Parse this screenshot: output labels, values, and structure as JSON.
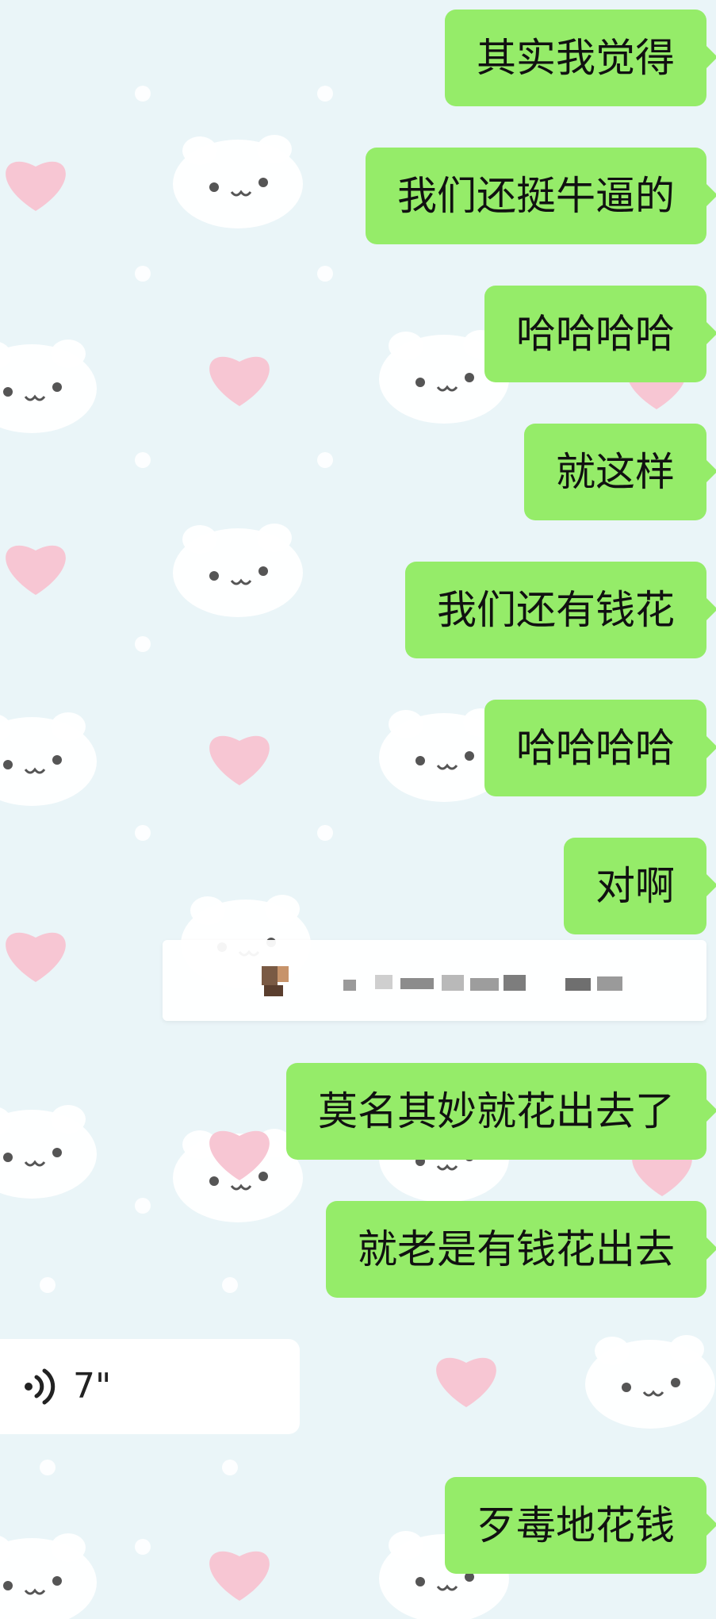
{
  "messages": [
    {
      "text": "其实我觉得"
    },
    {
      "text": "我们还挺牛逼的"
    },
    {
      "text": "哈哈哈哈"
    },
    {
      "text": "就这样"
    },
    {
      "text": "我们还有钱花"
    },
    {
      "text": "哈哈哈哈"
    },
    {
      "text": "对啊"
    },
    {
      "text": "莫名其妙就花出去了"
    },
    {
      "text": "就老是有钱花出去"
    },
    {
      "text": "歹毒地花钱"
    }
  ],
  "voice_message": {
    "duration": "7\"",
    "icon": "voice-wave-icon"
  },
  "quoted_card": {
    "note": "pixelated-content"
  },
  "colors": {
    "bubble_out": "#95ec69",
    "background": "#eaf5f8",
    "heart": "#f6c9d3",
    "cat": "#ffffff"
  }
}
